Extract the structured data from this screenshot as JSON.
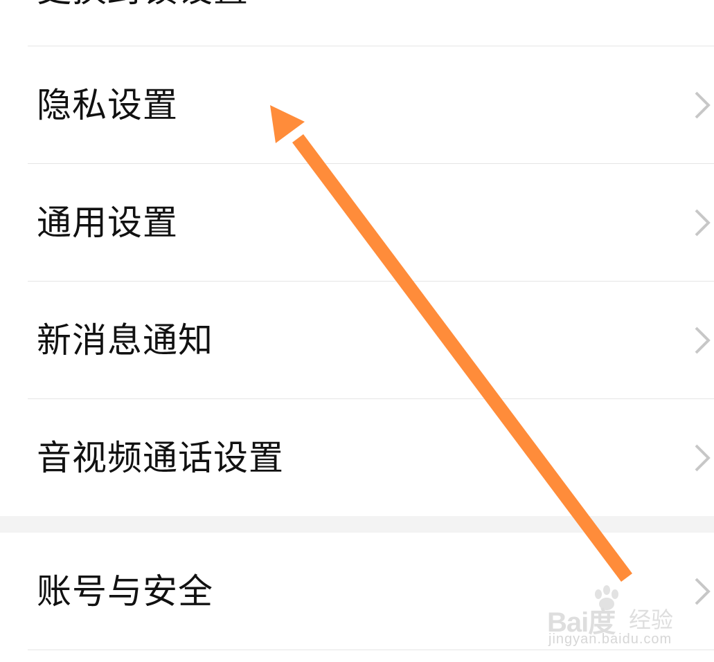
{
  "settings_list": {
    "top_item_label": "更换封锁设置",
    "items": [
      {
        "label": "隐私设置"
      },
      {
        "label": "通用设置"
      },
      {
        "label": "新消息通知"
      },
      {
        "label": "音视频通话设置"
      }
    ],
    "second_group": [
      {
        "label": "账号与安全"
      }
    ]
  },
  "annotation": {
    "arrow_color": "#FF8C3A",
    "arrow_target": "隐私设置"
  },
  "watermark": {
    "brand": "Bai度",
    "brand_suffix": "经验",
    "domain": "jingyan.baidu.com"
  },
  "colors": {
    "background": "#ffffff",
    "divider": "#e5e5e5",
    "group_gap": "#f3f3f3",
    "chevron": "#c7c7c7",
    "text": "#111111"
  }
}
